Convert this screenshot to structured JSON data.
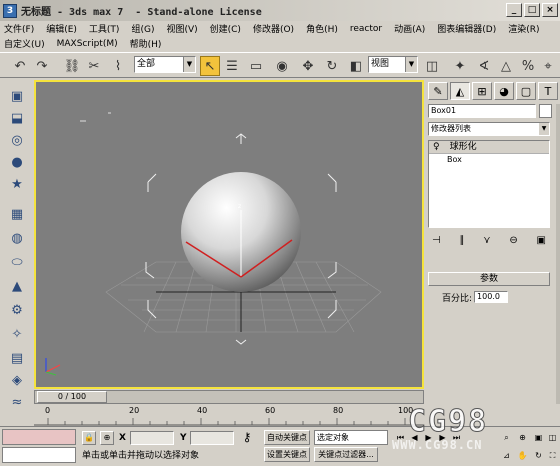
{
  "window": {
    "title": "无标题 - 3ds max 7  - Stand-alone License",
    "app_icon_letter": "3",
    "buttons": [
      "_",
      "□",
      "×"
    ]
  },
  "menu": {
    "row1": [
      "文件(F)",
      "编辑(E)",
      "工具(T)",
      "组(G)",
      "视图(V)",
      "创建(C)",
      "修改器(O)",
      "角色(H)",
      "reactor",
      "动画(A)",
      "图表编辑器(D)",
      "渲染(R)"
    ],
    "row2": [
      "自定义(U)",
      "MAXScript(M)",
      "帮助(H)"
    ]
  },
  "toolbar": {
    "selection_filter": "全部",
    "ref_coord": "视图"
  },
  "command_panel": {
    "object_name": "Box01",
    "modifier_list": "修改器列表",
    "stack_top": "球形化",
    "stack_base": "Box",
    "params_header": "参数",
    "percent_label": "百分比:",
    "percent_value": "100.0"
  },
  "timeline": {
    "slider": "0 / 100",
    "ticks": [
      "0",
      "20",
      "40",
      "60",
      "80",
      "100"
    ]
  },
  "status": {
    "x_label": "X",
    "y_label": "Y",
    "prompt": "单击或单击并拖动以选择对象",
    "auto_key": "自动关键点",
    "set_key": "设置关键点",
    "selected_dropdown": "选定对象",
    "key_filters": "关键点过滤器..."
  },
  "watermark": {
    "main": "CG98",
    "sub": "WWW.CG98.CN"
  },
  "colors": {
    "viewport_bg": "#7e7e7e",
    "viewport_border": "#f5e33c",
    "ui_gray": "#d4d0c8",
    "selected_tool": "#f3c33c"
  }
}
